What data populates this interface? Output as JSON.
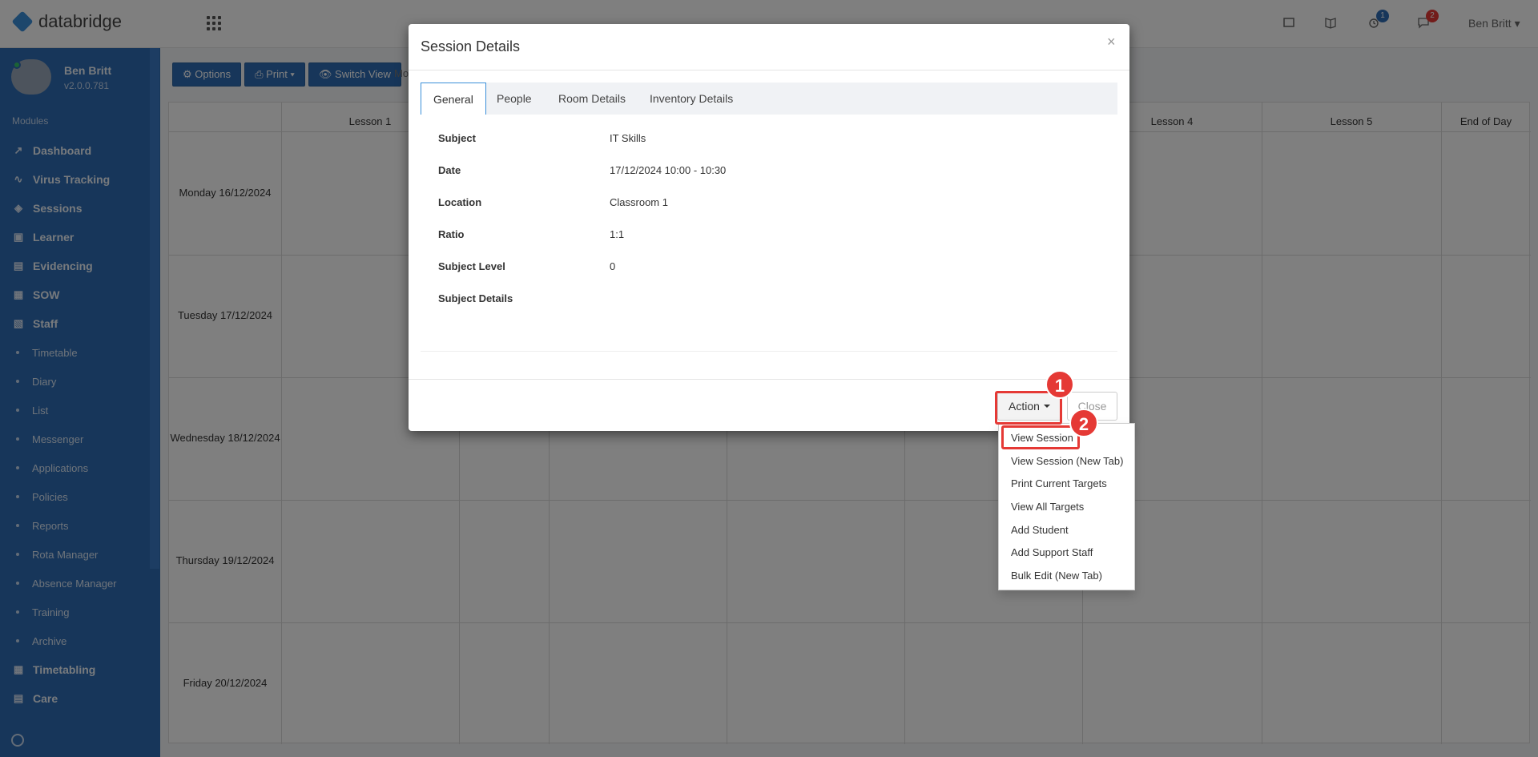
{
  "app": {
    "logo_text": "databridge"
  },
  "header": {
    "badges": {
      "tasks": "1",
      "messages": "2"
    },
    "user": "Ben Britt ▾"
  },
  "sidebar": {
    "profile_name": "Ben Britt",
    "profile_version": "v2.0.0.781",
    "heading": "Modules",
    "items": [
      {
        "label": "Dashboard",
        "icon": "chart-icon"
      },
      {
        "label": "Virus Tracking",
        "icon": "pulse-icon"
      },
      {
        "label": "Sessions",
        "icon": "layers-icon"
      },
      {
        "label": "Learner",
        "icon": "learner-icon"
      },
      {
        "label": "Evidencing",
        "icon": "camera-icon"
      },
      {
        "label": "SOW",
        "icon": "book-icon"
      },
      {
        "label": "Staff",
        "icon": "staff-icon"
      }
    ],
    "staff_subitems": [
      "Timetable",
      "Diary",
      "List",
      "Messenger",
      "Applications",
      "Policies",
      "Reports",
      "Rota Manager",
      "Absence Manager",
      "Training",
      "Archive"
    ],
    "bottom_items": [
      {
        "label": "Timetabling",
        "icon": "calendar-icon"
      },
      {
        "label": "Care",
        "icon": "table-icon"
      }
    ]
  },
  "toolbar": {
    "options": "⚙ Options",
    "print": "⎙ Print ▾",
    "switch_view": "👁 Switch View",
    "note": "Mo"
  },
  "timetable": {
    "headers": [
      "Lesson 1",
      "Lesson 4",
      "Lesson 5",
      "End of Day"
    ],
    "days": [
      "Monday 16/12/2024",
      "Tuesday 17/12/2024",
      "Wednesday 18/12/2024",
      "Thursday 19/12/2024",
      "Friday 20/12/2024"
    ]
  },
  "modal": {
    "title": "Session Details",
    "close_x": "×",
    "tabs": [
      "General",
      "People",
      "Room Details",
      "Inventory Details"
    ],
    "fields": [
      {
        "label": "Subject",
        "value": "IT Skills"
      },
      {
        "label": "Date",
        "value": "17/12/2024 10:00 - 10:30"
      },
      {
        "label": "Location",
        "value": "Classroom 1"
      },
      {
        "label": "Ratio",
        "value": "1:1"
      },
      {
        "label": "Subject Level",
        "value": "0"
      },
      {
        "label": "Subject Details",
        "value": ""
      }
    ],
    "action_label": "Action",
    "close_label": "Close"
  },
  "dropdown": {
    "items": [
      "View Session",
      "View Session (New Tab)",
      "Print Current Targets",
      "View All Targets",
      "Add Student",
      "Add Support Staff",
      "Bulk Edit (New Tab)"
    ]
  },
  "callouts": {
    "one": "1",
    "two": "2"
  },
  "colors": {
    "accent": "#2f6db5",
    "highlight": "#e53935"
  }
}
